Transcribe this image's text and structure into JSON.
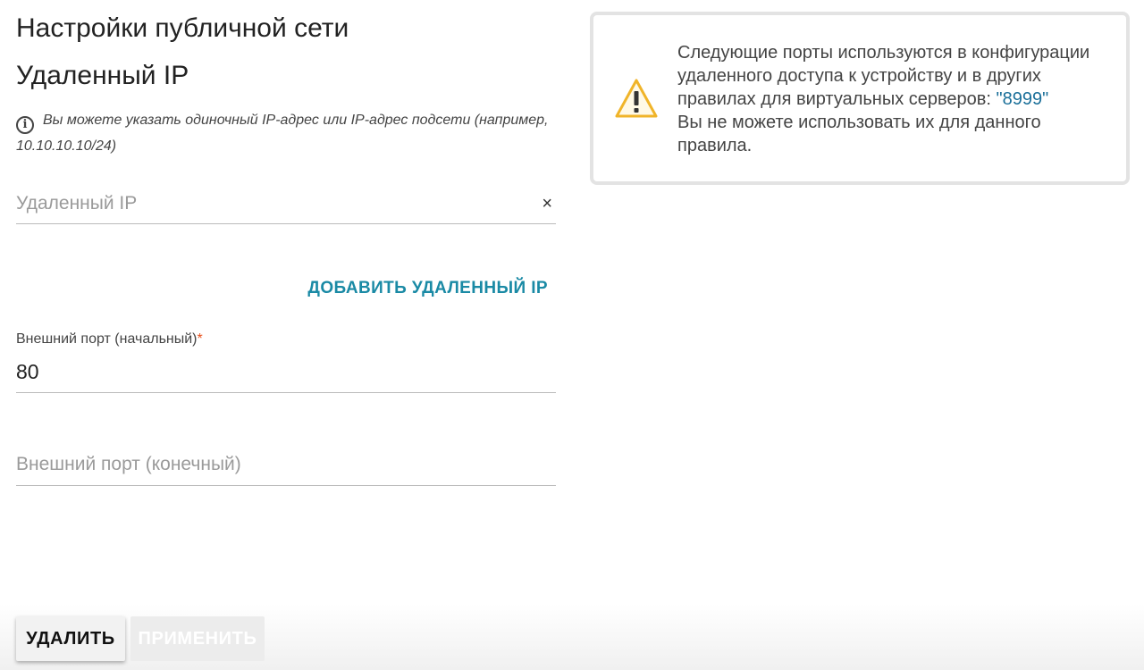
{
  "section": {
    "title": "Настройки публичной сети",
    "subtitle": "Удаленный IP"
  },
  "hint": {
    "icon": "info-icon",
    "icon_glyph": "i",
    "text": "Вы можете указать одиночный IP-адрес или IP-адрес подсети (например, 10.10.10.10/24)"
  },
  "remote_ip_field": {
    "placeholder": "Удаленный IP",
    "value": "",
    "clear_icon": "close-icon",
    "clear_glyph": "×"
  },
  "add_remote_ip": {
    "label": "ДОБАВИТЬ УДАЛЕННЫЙ IP"
  },
  "port_start_field": {
    "label": "Внешний порт (начальный)",
    "required_mark": "*",
    "value": "80"
  },
  "port_end_field": {
    "placeholder": "Внешний порт (конечный)",
    "value": ""
  },
  "alert": {
    "icon": "warning-icon",
    "text_before": "Следующие порты используются в конфигурации удаленного доступа к устройству и в других правилах для виртуальных серверов: ",
    "ports": "\"8999\"",
    "text_after": "Вы не можете использовать их для данного правила."
  },
  "buttons": {
    "delete_label": "УДАЛИТЬ",
    "apply_label": "ПРИМЕНИТЬ"
  },
  "colors": {
    "accent": "#1a8aa5",
    "required": "#e8501c",
    "warning": "#f0b429",
    "port_highlight": "#1a6f99"
  }
}
